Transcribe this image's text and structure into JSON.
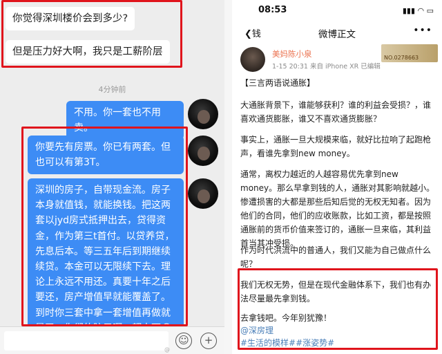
{
  "chat": {
    "message1": "你觉得深圳楼价会到多少?",
    "message2": "但是压力好大啊，我只是工薪阶层",
    "timestamp": "4分钟前",
    "reply1": "不用。你一套也不用卖。",
    "reply2": "你要先有房票。你已有两套。但也可以有第3T。",
    "reply3": "深圳的房子，自带现金流。房子本身就值钱，就能换钱。把这两套以jyd房式抵押出去，贷得资金，作为第三t首付。以贷养贷，先息后本。等三五年后到期继续续贷。本金可以无限续下去。理论上永远不用还。真要十年之后要还，房产增值早就能覆盖了。到时你三套中拿一套增值再做就是了。你们的脑子啊，都太死😂",
    "emoji_icon": "smile-icon",
    "add_icon": "plus-icon",
    "watermark": "@"
  },
  "weibo": {
    "status_time": "08:53",
    "status_icons": "▮▮▮ ◠ ▭",
    "back_label": "钱",
    "nav_title": "微博正文",
    "more_label": "•••",
    "username": "美妈陈小泉",
    "meta": "1-15 20:31  来自 iPhone XR  已编辑",
    "badge": "NO.0278663",
    "p_title": "【三言两语说通胀】",
    "p1": "大通胀背景下，谁能够获利？谁的利益会受损？，谁喜欢通货膨胀，谁又不喜欢通货膨胀？",
    "p2": "事实上，通胀一旦大规模来临，就好比拉响了起跑枪声，看谁先拿到new money。",
    "p3": "通常，离权力越近的人越容易优先拿到new money。那么早拿到钱的人，通胀对其影响就越小。惨遭损害的大都是那些后知后觉的无权无知者。因为他们的合同，他们的应收账款，比如工资，都是按照通胀前的货币价值来签订的，通胀一旦来临，其利益首当其冲受损。",
    "p4": "作为时代洪流中的普通人，我们又能为自己做点什么呢？",
    "p5": "我们无权无势，但是在现代金融体系下，我们也有办法尽量最先拿到钱。",
    "p6": "去拿钱吧。今年别犹豫！",
    "link1": "@深房理",
    "link2": "#生活的模样##涨姿势#"
  },
  "colors": {
    "highlight_red": "#e0141c",
    "chat_blue": "#3d8cf5",
    "weibo_orange": "#eb7350",
    "weibo_link": "#4a7fb8"
  }
}
